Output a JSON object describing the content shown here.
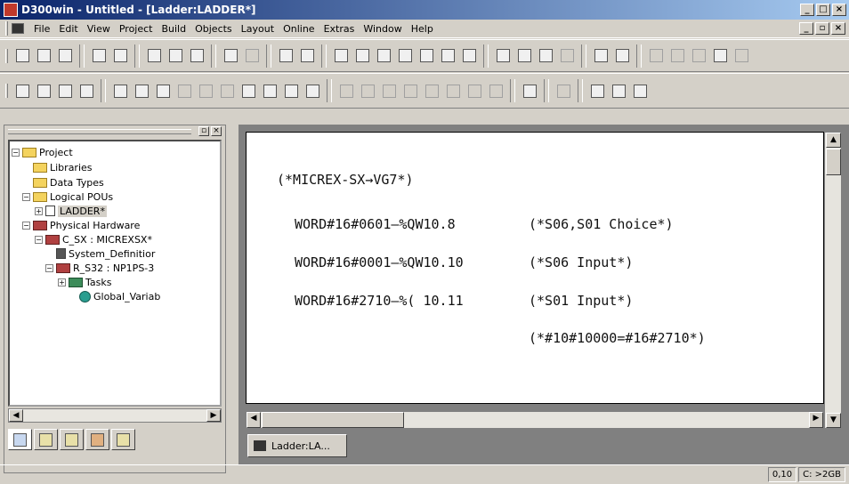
{
  "window": {
    "title": "D300win - Untitled - [Ladder:LADDER*]"
  },
  "menu": {
    "items": [
      "File",
      "Edit",
      "View",
      "Project",
      "Build",
      "Objects",
      "Layout",
      "Online",
      "Extras",
      "Window",
      "Help"
    ]
  },
  "toolbar1": {
    "icons": [
      "new-icon",
      "open-icon",
      "save-icon",
      "print-preview-icon",
      "print-icon",
      "cut-icon",
      "copy-icon",
      "paste-icon",
      "undo-icon",
      "redo-icon",
      "zoom-in-icon",
      "zoom-out-icon",
      "layout-icon",
      "window-icon",
      "wand-icon",
      "compile-icon",
      "make-icon",
      "build-icon",
      "monitor-icon",
      "online-icon",
      "transfer-icon",
      "download-icon",
      "upload-icon",
      "debug-icon",
      "grid-icon",
      "stop-icon",
      "pause-icon",
      "contact-icon",
      "variable-icon",
      "diagram-icon"
    ]
  },
  "toolbar2": {
    "icons": [
      "pou-icon",
      "pou-new-icon",
      "pou-open-icon",
      "pou-close-icon",
      "find-icon",
      "pointer-icon",
      "line-icon",
      "function-icon",
      "coil-icon",
      "jump-icon",
      "block-icon",
      "left-rail-icon",
      "right-rail-icon",
      "ladder-contact-icon",
      "open-contact-icon",
      "closed-contact-icon",
      "pos-edge-icon",
      "neg-edge-icon",
      "coil-normal-icon",
      "coil-set-icon",
      "coil-reset-icon",
      "branch-icon",
      "parallel-icon",
      "output-icon",
      "block-insert-icon",
      "return-icon",
      "comment-icon"
    ]
  },
  "tree": {
    "nodes": [
      {
        "label": "Project",
        "icon": "project-folder-icon",
        "toggle": "−"
      },
      {
        "label": "Libraries",
        "icon": "folder-icon",
        "toggle": ""
      },
      {
        "label": "Data Types",
        "icon": "folder-icon",
        "toggle": ""
      },
      {
        "label": "Logical POUs",
        "icon": "folder-icon",
        "toggle": "−"
      },
      {
        "label": "LADDER*",
        "icon": "pou-doc-icon",
        "toggle": "+"
      },
      {
        "label": "Physical Hardware",
        "icon": "hardware-folder-icon",
        "toggle": "−"
      },
      {
        "label": "C_SX : MICREXSX*",
        "icon": "configuration-icon",
        "toggle": "−"
      },
      {
        "label": "System_Definitior",
        "icon": "system-definition-icon",
        "toggle": ""
      },
      {
        "label": "R_S32 : NP1PS-3",
        "icon": "resource-icon",
        "toggle": "−"
      },
      {
        "label": "Tasks",
        "icon": "tasks-folder-icon",
        "toggle": "+"
      },
      {
        "label": "Global_Variab",
        "icon": "global-variables-icon",
        "toggle": ""
      }
    ]
  },
  "left_tabs": [
    "project-tree-tab-icon",
    "library-tab-icon",
    "book-tab-icon",
    "grid-tab-icon",
    "variables-tab-icon"
  ],
  "editor": {
    "lines": [
      "(*MICREX-SX→VG7*)",
      "WORD#16#0601—%QW10.8",
      "(*S06,S01 Choice*)",
      "WORD#16#0001—%QW10.10",
      "(*S06 Input*)",
      "WORD#16#2710—%( 10.11",
      "(*S01 Input*)",
      "(*#10#10000=#16#2710*)"
    ]
  },
  "document_tab": {
    "label": "Ladder:LA..."
  },
  "status": {
    "position": "0,10",
    "memory": "C: >2GB"
  }
}
